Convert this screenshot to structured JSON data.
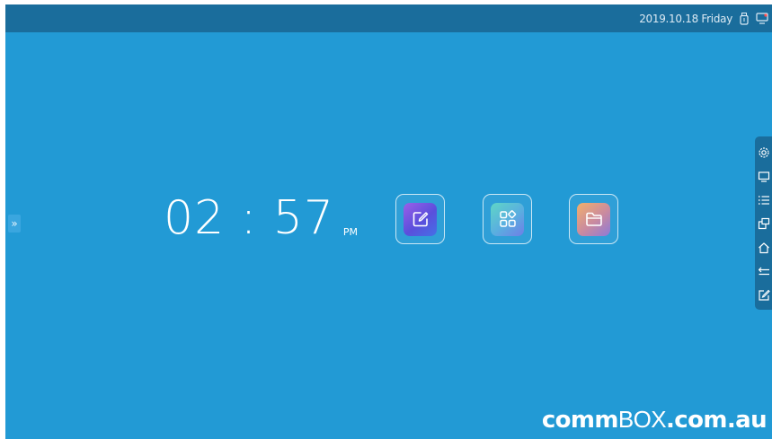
{
  "status_bar": {
    "datetime": "2019.10.18 Friday",
    "icons": [
      "usb-drive-icon",
      "screen-cast-icon"
    ]
  },
  "clock": {
    "time": "02 : 57",
    "ampm": "PM"
  },
  "apps": [
    {
      "icon": "note-edit-icon"
    },
    {
      "icon": "apps-grid-icon"
    },
    {
      "icon": "folder-icon"
    }
  ],
  "side_handle": {
    "glyph": "»"
  },
  "right_toolbar": {
    "items": [
      "settings-icon",
      "monitor-icon",
      "list-icon",
      "windows-icon",
      "home-icon",
      "back-icon",
      "annotate-icon"
    ]
  },
  "brand": {
    "bold1": "comm",
    "thin": "BOX",
    "bold2": ".com.au"
  },
  "colors": {
    "background": "#229ad5",
    "topbar": "#1a6d9c"
  }
}
